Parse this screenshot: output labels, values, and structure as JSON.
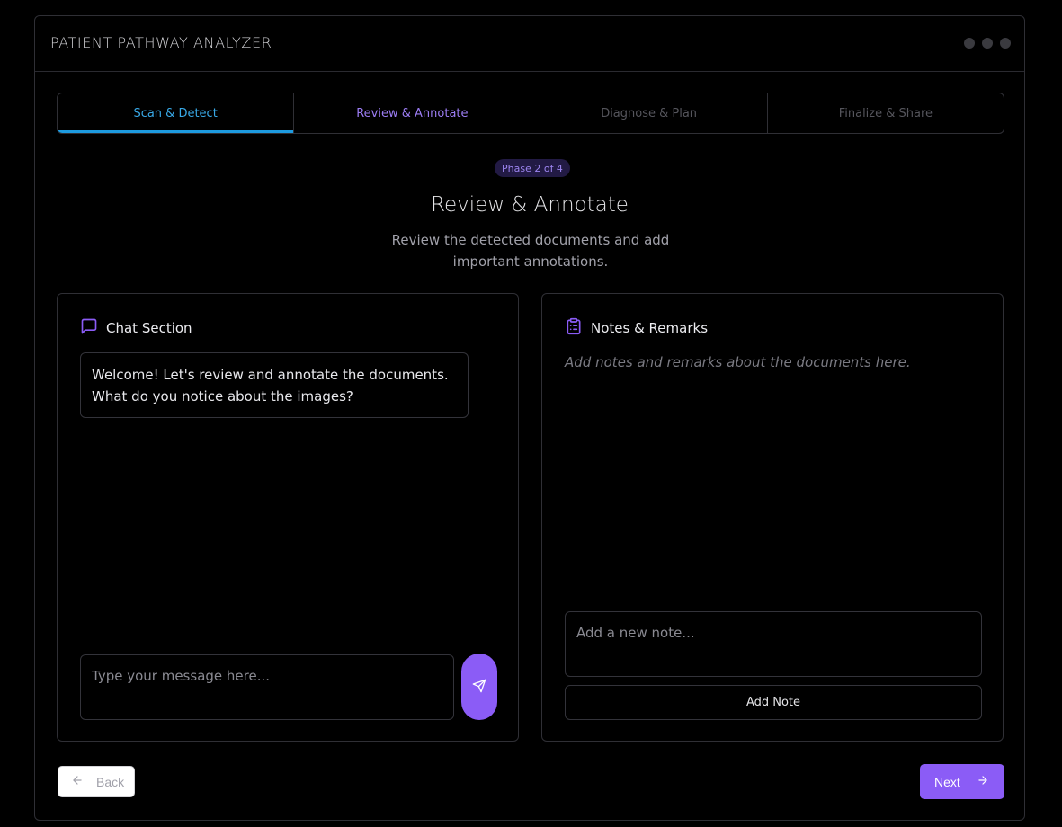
{
  "app": {
    "title": "PATIENT PATHWAY ANALYZER"
  },
  "stepper": {
    "steps": [
      {
        "label": "Scan & Detect",
        "state": "done"
      },
      {
        "label": "Review & Annotate",
        "state": "active"
      },
      {
        "label": "Diagnose & Plan",
        "state": "upcoming"
      },
      {
        "label": "Finalize & Share",
        "state": "upcoming"
      }
    ]
  },
  "phase": {
    "badge": "Phase 2 of 4",
    "title": "Review & Annotate",
    "subtitle": "Review the detected documents and add important annotations."
  },
  "chat": {
    "heading": "Chat Section",
    "icon": "message-square-icon",
    "messages": [
      {
        "text": "Welcome! Let's review and annotate the documents. What do you notice about the images?"
      }
    ],
    "input_placeholder": "Type your message here...",
    "send_icon": "send-icon"
  },
  "notes": {
    "heading": "Notes & Remarks",
    "icon": "clipboard-list-icon",
    "empty_text": "Add notes and remarks about the documents here.",
    "input_placeholder": "Add a new note...",
    "add_label": "Add Note"
  },
  "nav": {
    "back_label": "Back",
    "next_label": "Next"
  },
  "colors": {
    "accent": "#8b5cf6",
    "done": "#1d9be0",
    "active_text": "#9b7cf2"
  }
}
